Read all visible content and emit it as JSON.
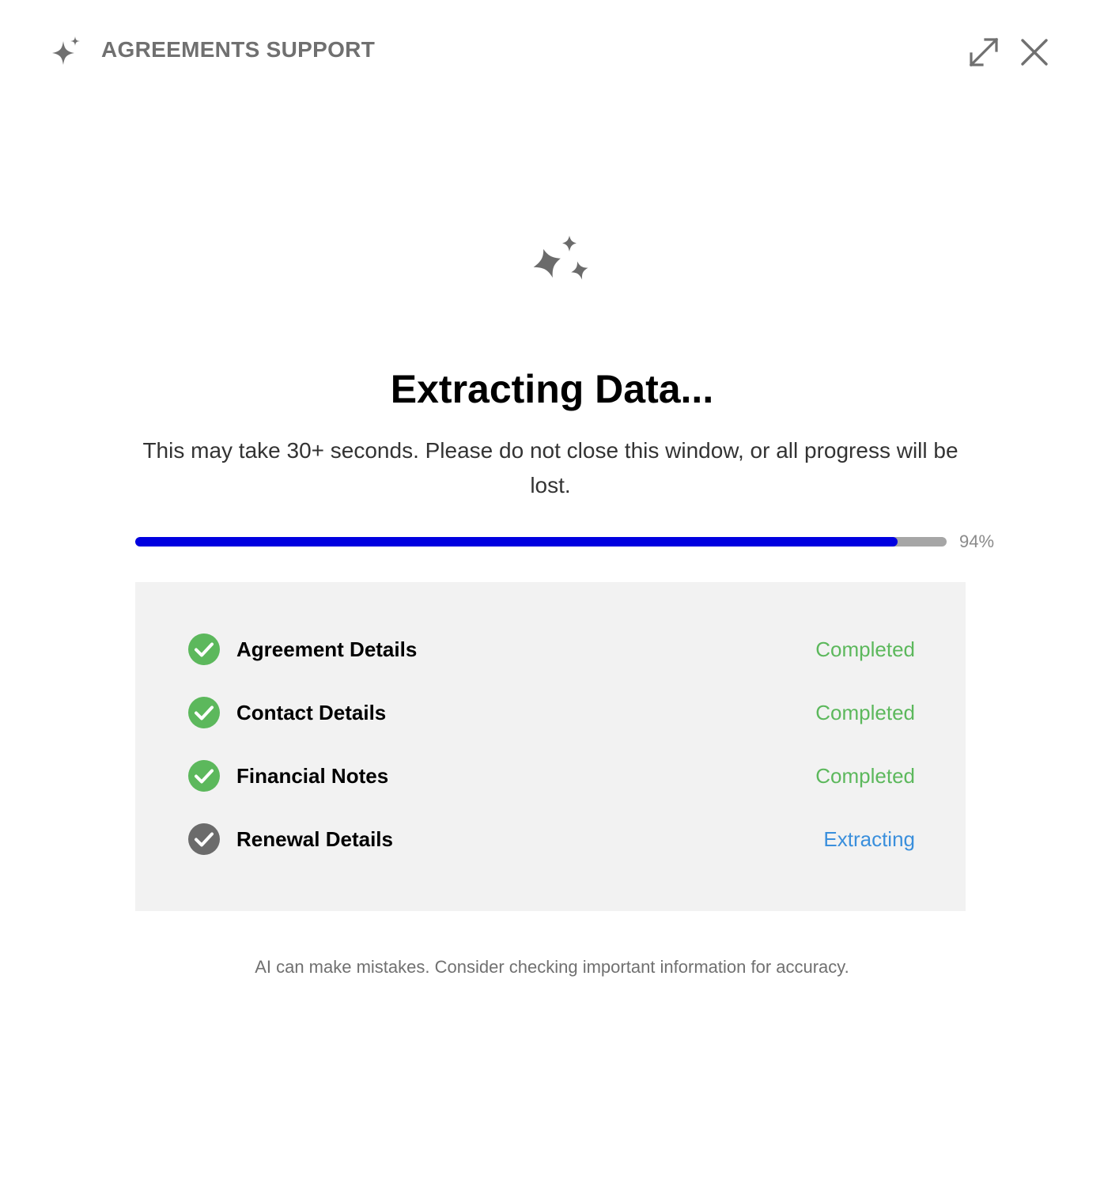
{
  "header": {
    "title": "AGREEMENTS SUPPORT",
    "icon": "sparkle-icon",
    "expand_icon": "expand-icon",
    "close_icon": "close-icon"
  },
  "main": {
    "hero_icon": "sparkles-icon",
    "heading": "Extracting Data...",
    "subtext": "This may take 30+ seconds. Please do not close this window, or all progress will be lost.",
    "progress": {
      "value": 94,
      "label": "94%"
    },
    "steps": [
      {
        "label": "Agreement Details",
        "status": "Completed",
        "state": "completed"
      },
      {
        "label": "Contact Details",
        "status": "Completed",
        "state": "completed"
      },
      {
        "label": "Financial Notes",
        "status": "Completed",
        "state": "completed"
      },
      {
        "label": "Renewal Details",
        "status": "Extracting",
        "state": "extracting"
      }
    ],
    "disclaimer": "AI can make mistakes. Consider checking important information for accuracy."
  },
  "colors": {
    "progress_fill": "#0000e0",
    "progress_track": "#a6a6a6",
    "completed": "#5cb85c",
    "extracting": "#3a8fdc",
    "pending_icon": "#6b6b6b",
    "panel_bg": "#f2f2f2"
  }
}
